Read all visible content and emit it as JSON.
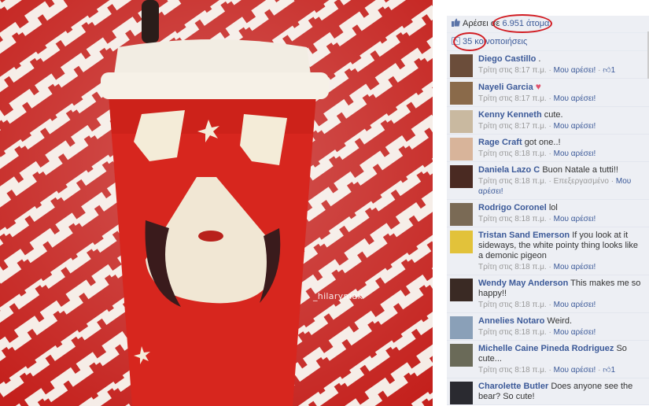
{
  "photo": {
    "watermark": "_hilarymak",
    "colors": {
      "background": "#c4201c",
      "pattern": "#f5ece6",
      "cup": "#d7261e",
      "lid": "#f2ede3"
    }
  },
  "panel": {
    "likes": {
      "prefix": "Αρέσει σε ",
      "count_text": "6.951 άτομα."
    },
    "shares": {
      "count": "35",
      "label": " κοινοποιήσεις"
    },
    "comments": [
      {
        "author": "Diego Castillo",
        "text": ".",
        "time": "Τρίτη στις 8:17 π.μ.",
        "like_label": "Μου αρέσει!",
        "likes": "1",
        "avatar_color": "#6b4d3a"
      },
      {
        "author": "Nayeli Garcia",
        "text": "♥",
        "time": "Τρίτη στις 8:17 π.μ.",
        "like_label": "Μου αρέσει!",
        "likes": "",
        "avatar_color": "#8a6a4a"
      },
      {
        "author": "Kenny Kenneth",
        "text": "cute.",
        "time": "Τρίτη στις 8:17 π.μ.",
        "like_label": "Μου αρέσει!",
        "likes": "",
        "avatar_color": "#c9b9a0"
      },
      {
        "author": "Rage Craft",
        "text": "got one..!",
        "time": "Τρίτη στις 8:18 π.μ.",
        "like_label": "Μου αρέσει!",
        "likes": "",
        "avatar_color": "#d8b49a"
      },
      {
        "author": "Daniela Lazo C",
        "text": "Buon Natale a tutti!!",
        "time": "Τρίτη στις 8:18 π.μ.",
        "extra": "Επεξεργασμένο",
        "like_label": "Μου αρέσει!",
        "likes": "",
        "avatar_color": "#4a2a22"
      },
      {
        "author": "Rodrigo Coronel",
        "text": "lol",
        "time": "Τρίτη στις 8:18 π.μ.",
        "like_label": "Μου αρέσει!",
        "likes": "",
        "avatar_color": "#7a6a55"
      },
      {
        "author": "Tristan Sand Emerson",
        "text": "If you look at it sideways, the white pointy thing looks like a demonic pigeon",
        "time": "Τρίτη στις 8:18 π.μ.",
        "like_label": "Μου αρέσει!",
        "likes": "",
        "avatar_color": "#e2c23a"
      },
      {
        "author": "Wendy May Anderson",
        "text": "This makes me so happy!!",
        "time": "Τρίτη στις 8:18 π.μ.",
        "like_label": "Μου αρέσει!",
        "likes": "",
        "avatar_color": "#3a2a24"
      },
      {
        "author": "Annelies Notaro",
        "text": "Weird.",
        "time": "Τρίτη στις 8:18 π.μ.",
        "like_label": "Μου αρέσει!",
        "likes": "",
        "avatar_color": "#8aa0b8"
      },
      {
        "author": "Michelle Caine Pineda Rodriguez",
        "text": "So cute...",
        "time": "Τρίτη στις 8:18 π.μ.",
        "like_label": "Μου αρέσει!",
        "likes": "1",
        "avatar_color": "#6a6a58"
      },
      {
        "author": "Charolette Butler",
        "text": "Does anyone see the bear? So cute!",
        "time": "",
        "like_label": "",
        "likes": "",
        "avatar_color": "#2a2a30"
      }
    ],
    "accent": "#3b5998",
    "highlight": "#d21d23"
  }
}
